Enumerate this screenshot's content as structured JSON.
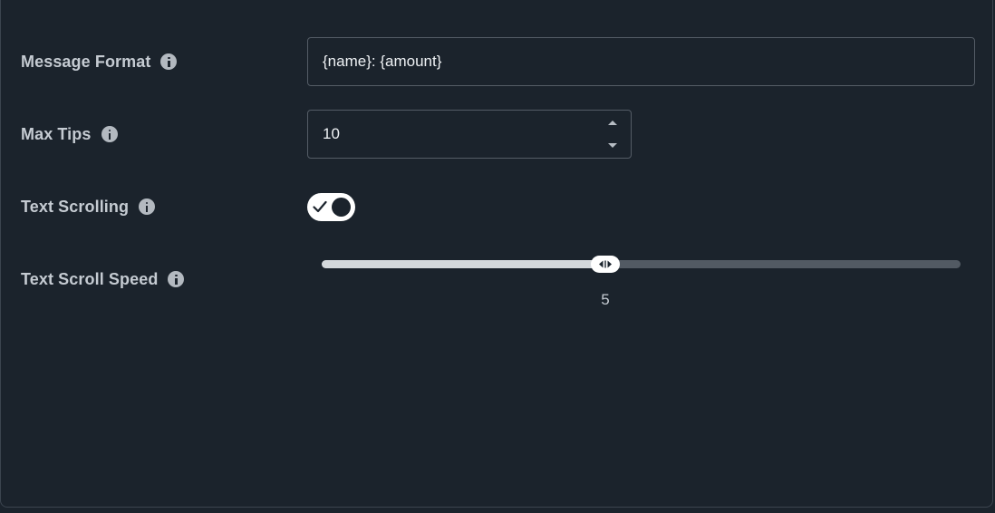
{
  "settings": {
    "message_format": {
      "label": "Message Format",
      "value": "{name}: {amount}"
    },
    "max_tips": {
      "label": "Max Tips",
      "value": "10"
    },
    "text_scrolling": {
      "label": "Text Scrolling",
      "enabled": true
    },
    "text_scroll_speed": {
      "label": "Text Scroll Speed",
      "value": "5",
      "fraction": 0.444
    }
  },
  "icons": {
    "info": "info-icon",
    "check": "check-icon",
    "slider_handle": "left-right-arrows-icon",
    "spinner_up": "caret-up-icon",
    "spinner_down": "caret-down-icon"
  },
  "colors": {
    "background": "#1b232c",
    "label_text": "#c5cbd2",
    "field_border": "#545c66",
    "track_inactive": "#525a63",
    "track_active": "#d4d8dc",
    "toggle_on": "#ffffff"
  }
}
